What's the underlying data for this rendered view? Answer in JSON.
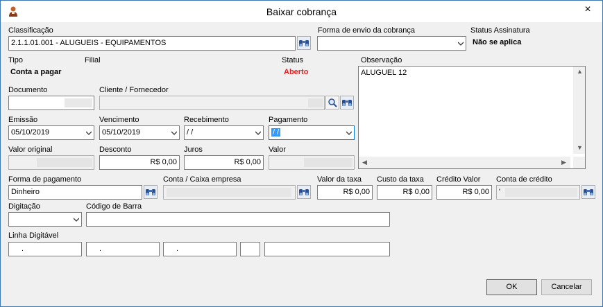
{
  "window": {
    "title": "Baixar cobrança",
    "close_glyph": "×"
  },
  "classificacao": {
    "label": "Classificação",
    "value": "2.1.1.01.001 - ALUGUEIS - EQUIPAMENTOS"
  },
  "forma_envio": {
    "label": "Forma de envio da cobrança",
    "value": ""
  },
  "status_assinatura": {
    "label": "Status Assinatura",
    "value": "Não se aplica"
  },
  "tipo": {
    "label": "Tipo",
    "value": "Conta a pagar"
  },
  "filial": {
    "label": "Filial"
  },
  "status": {
    "label": "Status",
    "value": "Aberto",
    "color": "#e21f1f"
  },
  "observacao": {
    "label": "Observação",
    "value": "ALUGUEL 12"
  },
  "documento": {
    "label": "Documento",
    "value": ""
  },
  "cliente": {
    "label": "Cliente / Fornecedor",
    "value": ""
  },
  "emissao": {
    "label": "Emissão",
    "value": "05/10/2019"
  },
  "vencimento": {
    "label": "Vencimento",
    "value": "05/10/2019"
  },
  "recebimento": {
    "label": "Recebimento",
    "value": " / /"
  },
  "pagamento": {
    "label": "Pagamento",
    "value": " / /"
  },
  "valor_original": {
    "label": "Valor original",
    "value": ""
  },
  "desconto": {
    "label": "Desconto",
    "value": "R$ 0,00"
  },
  "juros": {
    "label": "Juros",
    "value": "R$ 0,00"
  },
  "valor": {
    "label": "Valor",
    "value": ""
  },
  "forma_pagamento": {
    "label": "Forma de pagamento",
    "value": "Dinheiro"
  },
  "conta_caixa": {
    "label": "Conta / Caixa empresa",
    "value": ""
  },
  "valor_taxa": {
    "label": "Valor da taxa",
    "value": "R$ 0,00"
  },
  "custo_taxa": {
    "label": "Custo da taxa",
    "value": "R$ 0,00"
  },
  "credito_valor": {
    "label": "Crédito Valor",
    "value": "R$ 0,00"
  },
  "conta_credito": {
    "label": "Conta de crédito",
    "value": "'"
  },
  "digitacao": {
    "label": "Digitação",
    "value": ""
  },
  "codigo_barra": {
    "label": "Código de Barra",
    "value": ""
  },
  "linha_digitavel": {
    "label": "Linha Digitável",
    "p1": ".",
    "p2": ".",
    "p3": ".",
    "p4": "",
    "p5": ""
  },
  "buttons": {
    "ok": "OK",
    "cancel": "Cancelar"
  },
  "colors": {
    "accent": "#0078d7",
    "status_red": "#e21f1f"
  }
}
